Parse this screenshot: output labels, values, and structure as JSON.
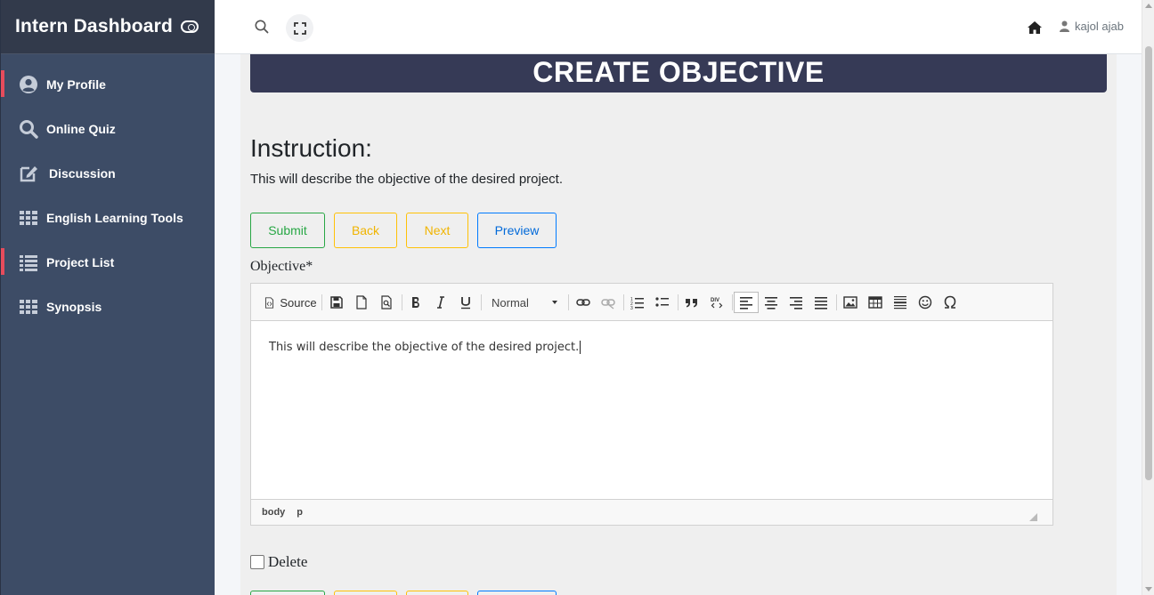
{
  "sidebar": {
    "brand": "Intern Dashboard",
    "items": [
      {
        "label": "My Profile",
        "icon": "user-circle-icon"
      },
      {
        "label": "Online Quiz",
        "icon": "search-icon"
      },
      {
        "label": "Discussion",
        "icon": "edit-icon"
      },
      {
        "label": "English Learning Tools",
        "icon": "grid-icon"
      },
      {
        "label": "Project List",
        "icon": "list-icon"
      },
      {
        "label": "Synopsis",
        "icon": "grid-icon"
      }
    ]
  },
  "topbar": {
    "user_name": "kajol ajab"
  },
  "page": {
    "title": "CREATE OBJECTIVE",
    "instruction_heading": "Instruction:",
    "instruction_text": "This will describe the objective of the desired project.",
    "buttons": {
      "submit": "Submit",
      "back": "Back",
      "next": "Next",
      "preview": "Preview"
    },
    "field_label": "Objective*",
    "delete_label": "Delete"
  },
  "editor": {
    "source_label": "Source",
    "format_value": "Normal",
    "content": "This will describe the objective of the desired project.",
    "path": [
      "body",
      "p"
    ]
  },
  "colors": {
    "sidebar": "#3d4c66",
    "title_bar": "#363a56",
    "submit": "#28a745",
    "warning": "#ffc107",
    "primary": "#007bff",
    "accent_marker": "#e74c5c"
  }
}
